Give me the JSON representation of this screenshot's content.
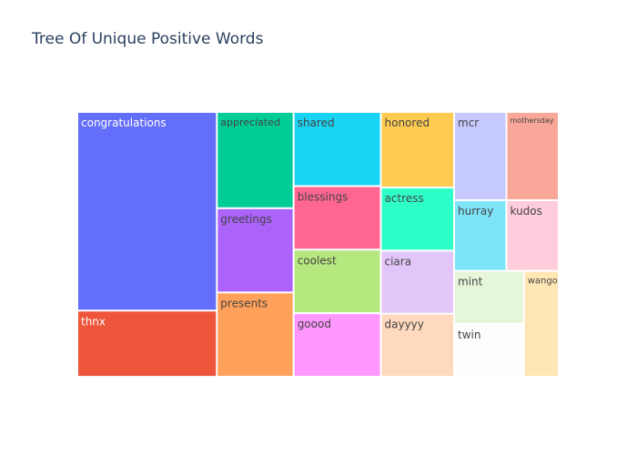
{
  "chart_data": {
    "type": "treemap",
    "title": "Tree Of Unique Positive Words",
    "tiles": [
      {
        "label": "congratulations",
        "value": 30,
        "color": "#636efa"
      },
      {
        "label": "thnx",
        "value": 10,
        "color": "#ef553b"
      },
      {
        "label": "appreciated",
        "value": 8,
        "color": "#00cc96"
      },
      {
        "label": "greetings",
        "value": 7,
        "color": "#ab63fa"
      },
      {
        "label": "presents",
        "value": 7,
        "color": "#ffa15a"
      },
      {
        "label": "shared",
        "value": 7,
        "color": "#19d3f3"
      },
      {
        "label": "blessings",
        "value": 6,
        "color": "#ff6692"
      },
      {
        "label": "coolest",
        "value": 6,
        "color": "#b6e880"
      },
      {
        "label": "goood",
        "value": 6,
        "color": "#ff97ff"
      },
      {
        "label": "honored",
        "value": 6,
        "color": "#fecb52"
      },
      {
        "label": "actress",
        "value": 5,
        "color": "#2effc8"
      },
      {
        "label": "ciara",
        "value": 5,
        "color": "#e2c6fa"
      },
      {
        "label": "dayyyy",
        "value": 5,
        "color": "#ffd9bd"
      },
      {
        "label": "mcr",
        "value": 5,
        "color": "#c6c9fd"
      },
      {
        "label": "mothersday",
        "value": 5,
        "color": "#f8a799"
      },
      {
        "label": "hurray",
        "value": 4,
        "color": "#7ee4f8"
      },
      {
        "label": "kudos",
        "value": 4,
        "color": "#ffccdc"
      },
      {
        "label": "mint",
        "value": 4,
        "color": "#e6f6d9"
      },
      {
        "label": "twin",
        "value": 4,
        "color": "#fefcff"
      },
      {
        "label": "wango",
        "value": 4,
        "color": "#ffe6b5"
      }
    ]
  }
}
